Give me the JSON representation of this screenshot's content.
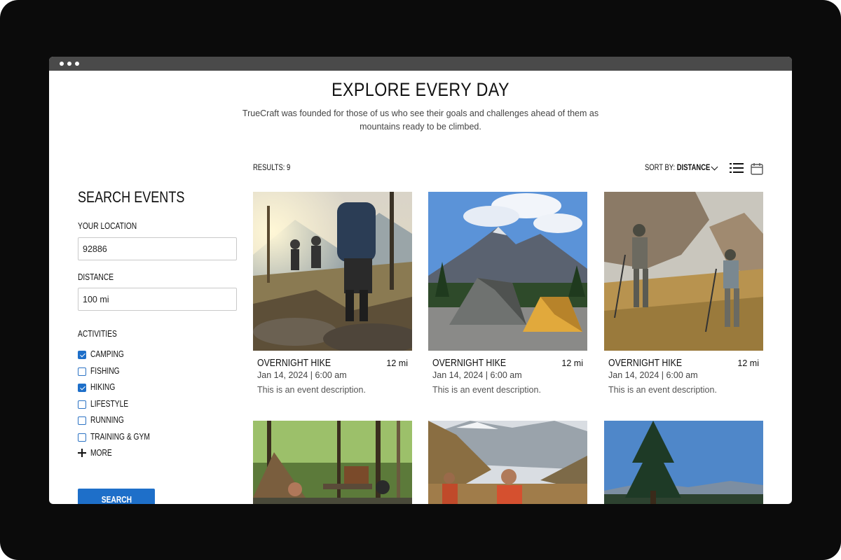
{
  "hero": {
    "title": "EXPLORE EVERY DAY",
    "subtitle": "TrueCraft was founded for those of us who see their goals and challenges ahead of them as mountains ready to be climbed."
  },
  "sidebar": {
    "title": "SEARCH EVENTS",
    "location_label": "YOUR LOCATION",
    "location_value": "92886",
    "distance_label": "DISTANCE",
    "distance_value": "100 mi",
    "activities_label": "ACTIVITIES",
    "activities": [
      {
        "label": "CAMPING",
        "checked": true
      },
      {
        "label": "FISHING",
        "checked": false
      },
      {
        "label": "HIKING",
        "checked": true
      },
      {
        "label": "LIFESTYLE",
        "checked": false
      },
      {
        "label": "RUNNING",
        "checked": false
      },
      {
        "label": "TRAINING & GYM",
        "checked": false
      }
    ],
    "more_label": "MORE",
    "search_button": "SEARCH"
  },
  "results": {
    "count_label": "RESULTS: 9",
    "sort_prefix": "SORT BY:",
    "sort_value": "DISTANCE"
  },
  "cards": [
    {
      "title": "OVERNIGHT HIKE",
      "distance": "12 mi",
      "date": "Jan 14, 2024 | 6:00 am",
      "description": "This is an event description."
    },
    {
      "title": "OVERNIGHT HIKE",
      "distance": "12 mi",
      "date": "Jan 14, 2024 | 6:00 am",
      "description": "This is an event description."
    },
    {
      "title": "OVERNIGHT HIKE",
      "distance": "12 mi",
      "date": "Jan 14, 2024 | 6:00 am",
      "description": "This is an event description."
    }
  ],
  "colors": {
    "accent": "#1e6fc9",
    "frame": "#0b0b0b",
    "titlebar": "#4a4a4a"
  },
  "icons": [
    "chevron-down-icon",
    "list-view-icon",
    "calendar-icon",
    "plus-icon",
    "checkbox-icon"
  ]
}
